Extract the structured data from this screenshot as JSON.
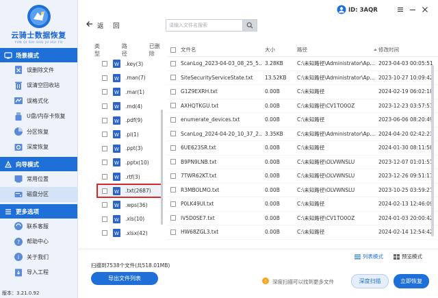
{
  "brand": {
    "name": "云骑士数据恢复",
    "pinyin": "YUN QI SHI SHU JU HUI FU"
  },
  "sidebar": {
    "sections": [
      {
        "title": "场景模式",
        "icon": "monitor-icon",
        "items": [
          {
            "label": "误删除文件",
            "icon": "delete-file-icon"
          },
          {
            "label": "误清空回收站",
            "icon": "recycle-bin-icon"
          },
          {
            "label": "误格式化",
            "icon": "format-icon"
          },
          {
            "label": "U盘/内存卡恢复",
            "icon": "usb-icon"
          },
          {
            "label": "分区恢复",
            "icon": "partition-icon"
          },
          {
            "label": "深度恢复",
            "icon": "deep-recovery-icon"
          }
        ]
      },
      {
        "title": "向导模式",
        "icon": "wizard-icon",
        "items": [
          {
            "label": "常用位置",
            "icon": "location-icon"
          },
          {
            "label": "磁盘分区",
            "icon": "disk-icon",
            "active": true
          }
        ]
      },
      {
        "title": "更多选项",
        "icon": "menu-icon",
        "items": [
          {
            "label": "联系客服",
            "icon": "support-icon"
          },
          {
            "label": "帮助中心",
            "icon": "help-icon"
          },
          {
            "label": "关于我们",
            "icon": "about-icon"
          },
          {
            "label": "导入工程",
            "icon": "import-icon"
          }
        ]
      }
    ],
    "version": "版本：3.21.0.92"
  },
  "topbar": {
    "back_label": "返",
    "home_label": "回",
    "search_placeholder": "请输入文件名搜索",
    "user_id": "ID: 3AQR"
  },
  "tree": {
    "headers": [
      "类型",
      "路径",
      "已删除"
    ],
    "items": [
      {
        "label": ".key(3)"
      },
      {
        "label": ".man(7)"
      },
      {
        "label": ".mar(1)"
      },
      {
        "label": ".md(4)"
      },
      {
        "label": ".pdf(9)"
      },
      {
        "label": ".pl(1)"
      },
      {
        "label": ".ppt(3)"
      },
      {
        "label": ".pptx(10)"
      },
      {
        "label": ".rtf(3)"
      },
      {
        "label": ".txt(2687)",
        "selected": true
      },
      {
        "label": ".wps(36)"
      },
      {
        "label": ".xls(10)"
      },
      {
        "label": ".xlsx(42)"
      }
    ]
  },
  "table": {
    "headers": {
      "name": "文件名",
      "size": "大小",
      "path": "路径",
      "time": "修改时间"
    },
    "rows": [
      {
        "name": "ScanLog_2023-04-03_08_25_5...",
        "size": "3.28KB",
        "path": "C:\\未知路径\\Administrator\\Ap...",
        "time": "2023-04-03 00:05:51"
      },
      {
        "name": "SiteSecurityServiceState.txt",
        "size": "13.52KB",
        "path": "C:\\未知路径\\Administrator\\Ap...",
        "time": "2023-10-27 10:09:42"
      },
      {
        "name": "G1Z9EXRH.txt",
        "size": "0.00B",
        "path": "C:\\未知路径",
        "time": "2024-02-19 06:02:18"
      },
      {
        "name": "AXHQTKGU.txt",
        "size": "0.00B",
        "path": "C:\\未知路径\\CV1TO0OZ",
        "time": "2023-12-23 03:57:51"
      },
      {
        "name": "enumerate_devices.txt",
        "size": "0.00B",
        "path": "C:\\未知路径",
        "time": "2023-06-06 08:20:49"
      },
      {
        "name": "ScanLog_2024-04-20_10_37_2...",
        "size": "3.35KB",
        "path": "C:\\未知路径\\Administrator\\Ap...",
        "time": "2024-04-20 02:42:23"
      },
      {
        "name": "6UE623SR.txt",
        "size": "0.00B",
        "path": "C:\\未知路径",
        "time": "2024-01-30 08:11:58"
      },
      {
        "name": "B9PN9LNB.txt",
        "size": "0.00B",
        "path": "C:\\未知路径\\OLVWNSLU",
        "time": "2023-12-07 01:01:51"
      },
      {
        "name": "7TWR62KT.txt",
        "size": "0.00B",
        "path": "C:\\未知路径\\OLVWNSLU",
        "time": "2023-12-26 09:51:11"
      },
      {
        "name": "R3MBOLMO.txt",
        "size": "0.00B",
        "path": "C:\\未知路径\\OLVWNSLU",
        "time": "2023-10-25 03:59:21"
      },
      {
        "name": "P0LK49UI.txt",
        "size": "0.00B",
        "path": "C:\\未知路径",
        "time": "2024-02-13 12:46:09"
      },
      {
        "name": "IV5D0SE7.txt",
        "size": "0.00B",
        "path": "C:\\未知路径\\CV1TO0OZ",
        "time": "2024-01-03 20:00:42"
      },
      {
        "name": "HW68ZGL3.txt",
        "size": "0.00B",
        "path": "C:\\未知路径",
        "time": "2024-02-14 12:54:42"
      }
    ]
  },
  "bottom": {
    "view_list": "列表模式",
    "view_thumb": "预览模式",
    "scan_info": "扫描到7538个文件(共518.01MB)",
    "export_label": "导出文件列表",
    "tip_text": "深度扫描可以找到更多文件",
    "deep_scan_label": "深度扫描",
    "recover_label": "立即恢复"
  },
  "colors": {
    "accent": "#1e6fd8",
    "highlight": "#d9262b",
    "sidebar_bg": "#eef3fb"
  }
}
